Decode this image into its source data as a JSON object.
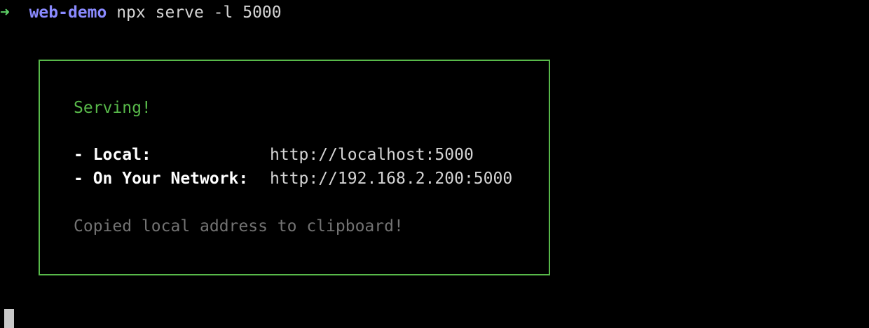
{
  "prompt": {
    "arrow": "➜",
    "directory": "web-demo",
    "command": "npx serve -l 5000"
  },
  "serve_box": {
    "status": "Serving!",
    "local_label": "- Local:",
    "local_url": "http://localhost:5000",
    "network_label": "- On Your Network:",
    "network_url": "http://192.168.2.200:5000",
    "clipboard_message": "Copied local address to clipboard!"
  },
  "colors": {
    "background": "#000000",
    "prompt_arrow": "#5ccf66",
    "directory": "#8a8aff",
    "box_border": "#58b94a",
    "serving_text": "#58b94a",
    "dim_text": "#737373"
  }
}
